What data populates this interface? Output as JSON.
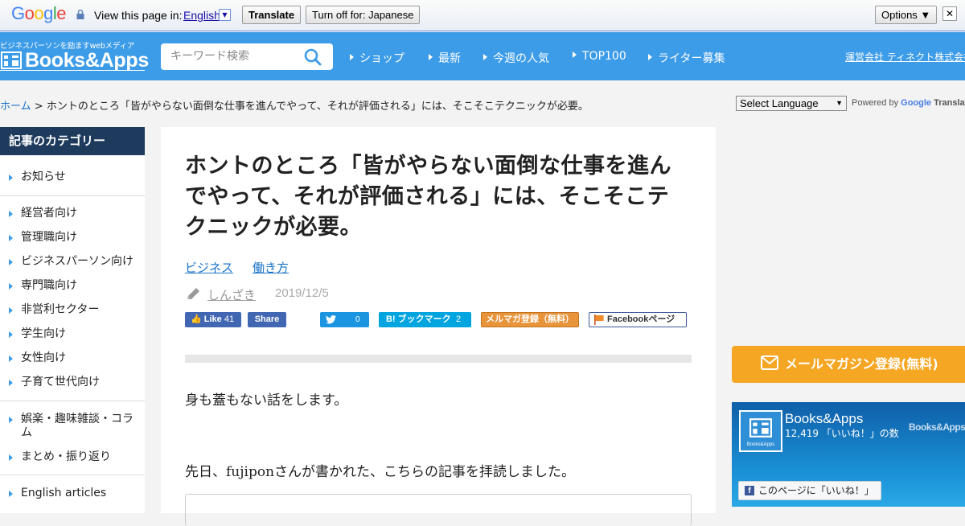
{
  "translate_bar": {
    "logo": "Google",
    "view_text": "View this page in:",
    "language": "English",
    "translate_label": "Translate",
    "turn_off_label": "Turn off for: Japanese",
    "options_label": "Options ▼",
    "close_label": "✕"
  },
  "header": {
    "tagline": "ビジネスパーソンを励ますwebメディア",
    "logo_text": "Books&Apps",
    "search_placeholder": "キーワード検索",
    "nav": [
      "ショップ",
      "最新",
      "今週の人気",
      "TOP100",
      "ライター募集"
    ],
    "company_link": "運営会社 ティネクト株式会社"
  },
  "breadcrumb": {
    "home": "ホーム",
    "separator": ">",
    "current": "ホントのところ「皆がやらない面倒な仕事を進んでやって、それが評価される」には、そこそこテクニックが必要。"
  },
  "language_select": {
    "value": "Select Language",
    "powered_by": "Powered by",
    "google": "Google",
    "translate": "Translate"
  },
  "sidebar": {
    "heading": "記事のカテゴリー",
    "items": [
      "お知らせ",
      "経営者向け",
      "管理職向け",
      "ビジネスパーソン向け",
      "専門職向け",
      "非営利セクター",
      "学生向け",
      "女性向け",
      "子育て世代向け",
      "娯楽・趣味雑談・コラム",
      "まとめ・振り返り",
      "English articles"
    ]
  },
  "article": {
    "title": "ホントのところ「皆がやらない面倒な仕事を進んでやって、それが評価される」には、そこそこテクニックが必要。",
    "tags": [
      "ビジネス",
      "働き方"
    ],
    "author": "しんざき",
    "date": "2019/12/5",
    "share": {
      "fb_like": "Like",
      "fb_like_count": "41",
      "fb_share": "Share",
      "tweet_count": "0",
      "hatena_label": "B! ブックマーク",
      "hatena_count": "2",
      "mailmag": "メルマガ登録（無料）",
      "fb_page": "Facebookページ"
    },
    "paragraphs": [
      "身も蓋もない話をします。",
      "先日、fujiponさんが書かれた、こちらの記事を拝読しました。"
    ]
  },
  "right": {
    "mail_button": "メールマガジン登録(無料)",
    "fb_name": "Books&Apps",
    "fb_count": "12,419 「いいね！」の数",
    "fb_watermark": "Books&Apps",
    "fb_like_button": "このページに「いいね！」"
  },
  "colors": {
    "header_blue": "#3d9ce8",
    "sidebar_head": "#1e3a5c",
    "link": "#1a73c8",
    "mail_orange": "#f5a623"
  }
}
